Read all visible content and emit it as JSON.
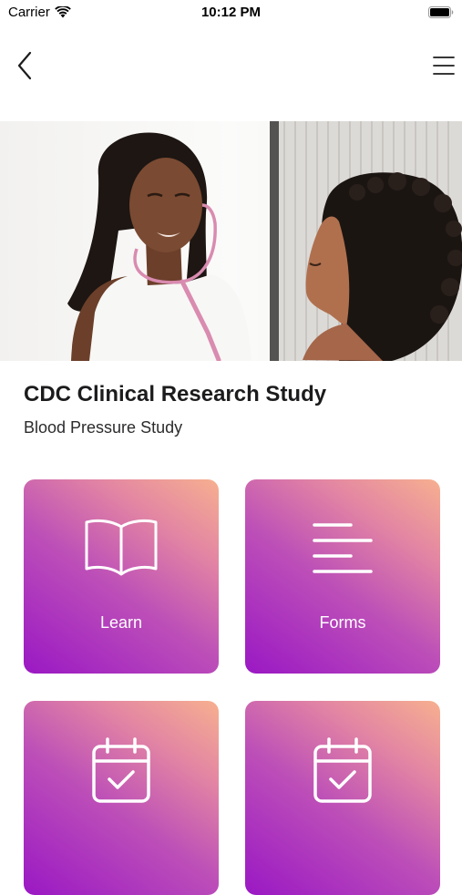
{
  "status_bar": {
    "carrier": "Carrier",
    "time": "10:12 PM"
  },
  "nav": {
    "back_icon": "chevron-left-icon",
    "menu_icon": "hamburger-menu-icon"
  },
  "hero": {
    "image": "doctor-with-stethoscope-talking-to-patient"
  },
  "study": {
    "title": "CDC Clinical Research Study",
    "subtitle": "Blood Pressure Study"
  },
  "tiles": [
    {
      "label": "Learn",
      "icon": "open-book-icon"
    },
    {
      "label": "Forms",
      "icon": "text-lines-icon"
    },
    {
      "label": "",
      "icon": "calendar-check-icon"
    },
    {
      "label": "",
      "icon": "calendar-check-icon"
    }
  ],
  "colors": {
    "tile_gradient_start": "#9a18c4",
    "tile_gradient_end": "#f7b08f",
    "text": "#1c1c1e"
  }
}
